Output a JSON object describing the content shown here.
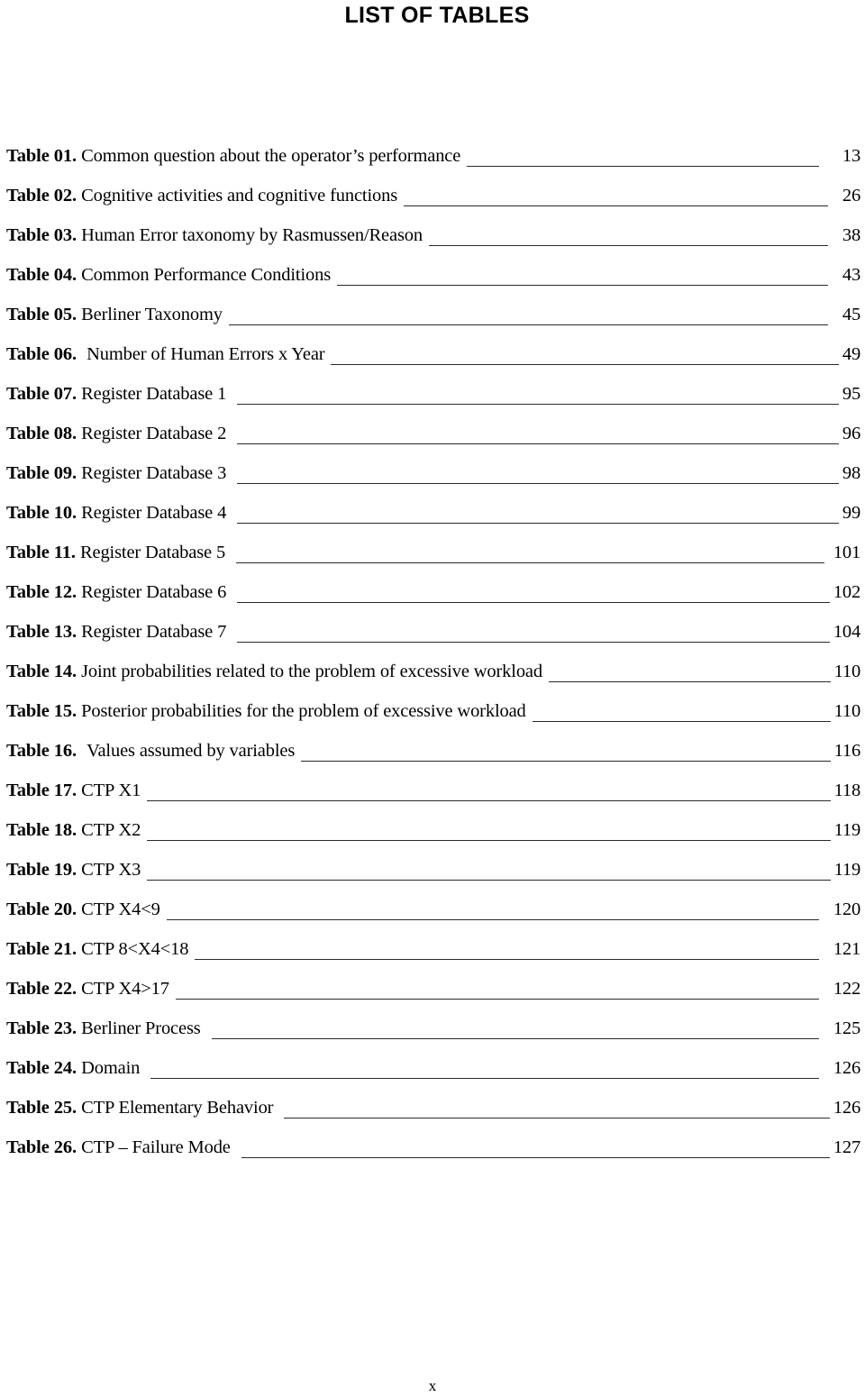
{
  "document": {
    "title": "LIST OF TABLES",
    "folio": "x"
  },
  "entries": [
    {
      "label": "Table 01.",
      "title": "Common question about the operator’s performance",
      "page": "13"
    },
    {
      "label": "Table 02.",
      "title": "Cognitive activities and cognitive functions",
      "page": "26"
    },
    {
      "label": "Table 03.",
      "title": "Human Error taxonomy by Rasmussen/Reason",
      "page": "38"
    },
    {
      "label": "Table 04.",
      "title": "Common Performance Conditions",
      "page": "43"
    },
    {
      "label": "Table 05.",
      "title": "Berliner Taxonomy",
      "page": "45"
    },
    {
      "label": "Table 06.",
      "title": "Number of Human Errors x Year",
      "page": "49"
    },
    {
      "label": "Table 07.",
      "title": "Register Database 1",
      "page": "95"
    },
    {
      "label": "Table 08.",
      "title": "Register Database 2",
      "page": "96"
    },
    {
      "label": "Table 09.",
      "title": "Register Database 3",
      "page": "98"
    },
    {
      "label": "Table 10.",
      "title": "Register Database 4",
      "page": "99"
    },
    {
      "label": "Table 11.",
      "title": "Register Database 5",
      "page": "101"
    },
    {
      "label": "Table 12.",
      "title": "Register Database 6",
      "page": "102"
    },
    {
      "label": "Table 13.",
      "title": "Register Database 7",
      "page": "104"
    },
    {
      "label": "Table 14.",
      "title": "Joint probabilities related to the problem of excessive workload",
      "page": "110"
    },
    {
      "label": "Table 15.",
      "title": "Posterior probabilities for the problem of excessive workload",
      "page": "110"
    },
    {
      "label": "Table 16.",
      "title": "Values assumed by variables",
      "page": "116"
    },
    {
      "label": "Table 17.",
      "title": "CTP X1",
      "page": "118"
    },
    {
      "label": "Table 18.",
      "title": "CTP X2",
      "page": "119"
    },
    {
      "label": "Table 19.",
      "title": "CTP X3",
      "page": "119"
    },
    {
      "label": "Table 20.",
      "title": "CTP X4<9",
      "page": "120"
    },
    {
      "label": "Table 21.",
      "title": "CTP 8<X4<18",
      "page": "121"
    },
    {
      "label": "Table 22.",
      "title": "CTP X4>17",
      "page": "122"
    },
    {
      "label": "Table 23.",
      "title": "Berliner Process",
      "page": "125"
    },
    {
      "label": "Table 24.",
      "title": "Domain",
      "page": "126"
    },
    {
      "label": "Table 25.",
      "title": "CTP Elementary Behavior",
      "page": "126"
    },
    {
      "label": "Table 26.",
      "title": "CTP – Failure Mode",
      "page": "127"
    }
  ]
}
